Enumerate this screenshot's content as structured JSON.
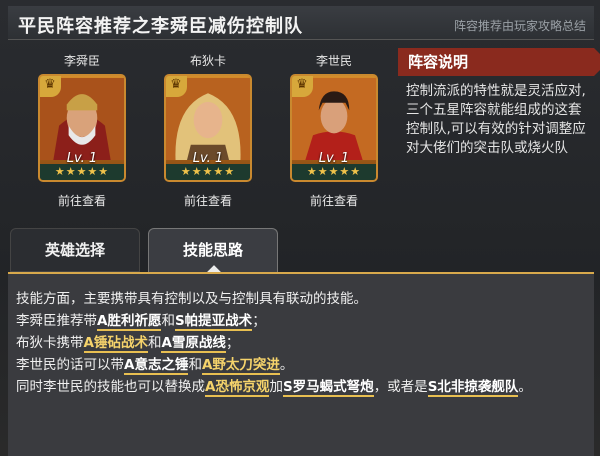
{
  "header": {
    "title": "平民阵容推荐之李舜臣减伤控制队",
    "subtitle": "阵容推荐由玩家攻略总结"
  },
  "heroes": [
    {
      "name": "李舜臣",
      "level": "Lv. 1",
      "stars": "★★★★★",
      "view": "前往查看"
    },
    {
      "name": "布狄卡",
      "level": "Lv. 1",
      "stars": "★★★★★",
      "view": "前往查看"
    },
    {
      "name": "李世民",
      "level": "Lv. 1",
      "stars": "★★★★★",
      "view": "前往查看"
    }
  ],
  "description": {
    "heading": "阵容说明",
    "text": "控制流派的特性就是灵活应对,三个五星阵容就能组成的这套控制队,可以有效的针对调整应对大佬们的突击队或烧火队"
  },
  "tabs": [
    {
      "label": "英雄选择"
    },
    {
      "label": "技能思路"
    }
  ],
  "skills": {
    "l1": "技能方面，主要携带具有控制以及与控制具有联动的技能。",
    "l2a": "李舜臣推荐带",
    "l2b": "A胜利祈愿",
    "l2c": "和",
    "l2d": "S帕提亚战术",
    "l2e": "；",
    "l3a": "布狄卡携带",
    "l3b": "A锤砧战术",
    "l3c": "和",
    "l3d": "A雪原战线",
    "l3e": "；",
    "l4a": "李世民的话可以带",
    "l4b": "A意志之锤",
    "l4c": "和",
    "l4d": "A野太刀突进",
    "l4e": "。",
    "l5a": "同时李世民的技能也可以替换成",
    "l5b": "A恐怖京观",
    "l5c": "加",
    "l5d": "S罗马蝎式弩炮",
    "l5e": "，或者是",
    "l5f": "S北非掠袭舰队",
    "l5g": "。"
  }
}
